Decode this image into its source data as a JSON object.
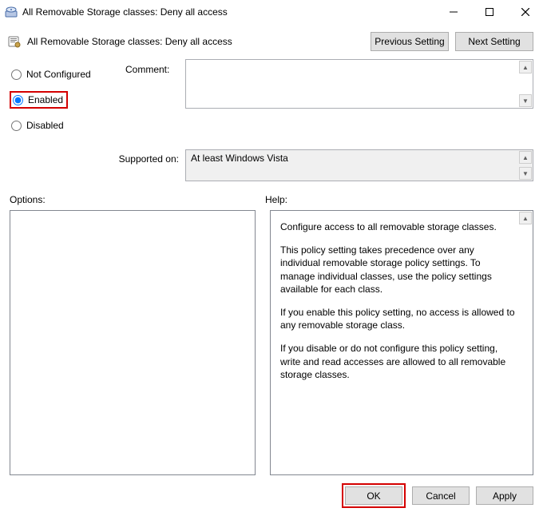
{
  "window": {
    "title": "All Removable Storage classes: Deny all access"
  },
  "header": {
    "setting_name": "All Removable Storage classes: Deny all access",
    "previous_setting": "Previous Setting",
    "next_setting": "Next Setting"
  },
  "state": {
    "not_configured": "Not Configured",
    "enabled": "Enabled",
    "disabled": "Disabled",
    "selected": "enabled"
  },
  "labels": {
    "comment": "Comment:",
    "supported_on": "Supported on:",
    "options": "Options:",
    "help": "Help:"
  },
  "supported_on_value": "At least Windows Vista",
  "help": {
    "p1": "Configure access to all removable storage classes.",
    "p2": "This policy setting takes precedence over any individual removable storage policy settings. To manage individual classes, use the policy settings available for each class.",
    "p3": "If you enable this policy setting, no access is allowed to any removable storage class.",
    "p4": "If you disable or do not configure this policy setting, write and read accesses are allowed to all removable storage classes."
  },
  "buttons": {
    "ok": "OK",
    "cancel": "Cancel",
    "apply": "Apply"
  }
}
